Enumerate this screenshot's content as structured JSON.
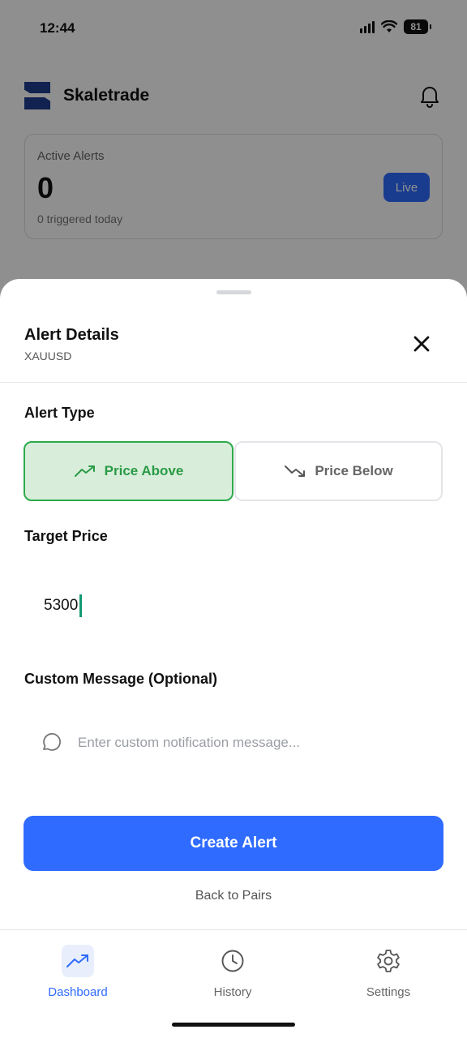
{
  "status_bar": {
    "time": "12:44",
    "battery": "81"
  },
  "app": {
    "title": "Skaletrade"
  },
  "active_card": {
    "label": "Active Alerts",
    "count": "0",
    "subtext": "0 triggered today",
    "live_label": "Live"
  },
  "sheet": {
    "title": "Alert Details",
    "subtitle": "XAUUSD",
    "alert_type_label": "Alert Type",
    "types": [
      {
        "label": "Price Above",
        "selected": true
      },
      {
        "label": "Price Below",
        "selected": false
      }
    ],
    "target_price_label": "Target Price",
    "target_price_value": "5300",
    "custom_message_label": "Custom Message (Optional)",
    "custom_message_placeholder": "Enter custom notification message...",
    "create_label": "Create Alert",
    "back_label": "Back to Pairs"
  },
  "tabs": [
    {
      "label": "Dashboard",
      "icon": "trending-up-icon",
      "active": true
    },
    {
      "label": "History",
      "icon": "clock-icon",
      "active": false
    },
    {
      "label": "Settings",
      "icon": "gear-icon",
      "active": false
    }
  ],
  "colors": {
    "accent": "#2f6bff",
    "brand": "#1f3c8f",
    "success": "#2eaa4b",
    "success_bg": "#d8eedb",
    "caret": "#139973"
  }
}
